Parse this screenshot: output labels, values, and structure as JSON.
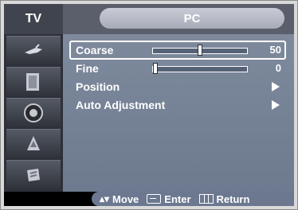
{
  "header": {
    "tv_tab": "TV",
    "title": "PC"
  },
  "sidebar": {
    "items": [
      {
        "icon": "antenna-icon"
      },
      {
        "icon": "picture-icon"
      },
      {
        "icon": "speaker-icon"
      },
      {
        "icon": "channel-icon"
      },
      {
        "icon": "setup-icon"
      }
    ]
  },
  "menu": {
    "coarse": {
      "label": "Coarse",
      "value": "50",
      "level": 50,
      "max": 100
    },
    "fine": {
      "label": "Fine",
      "value": "0",
      "level": 0,
      "max": 100
    },
    "position": {
      "label": "Position"
    },
    "auto": {
      "label": "Auto Adjustment"
    }
  },
  "footer": {
    "move": "Move",
    "enter": "Enter",
    "return": "Return"
  },
  "colors": {
    "accent": "#7e8a9c",
    "header": "#5a5f6b",
    "sidebar": "#2d3038"
  }
}
